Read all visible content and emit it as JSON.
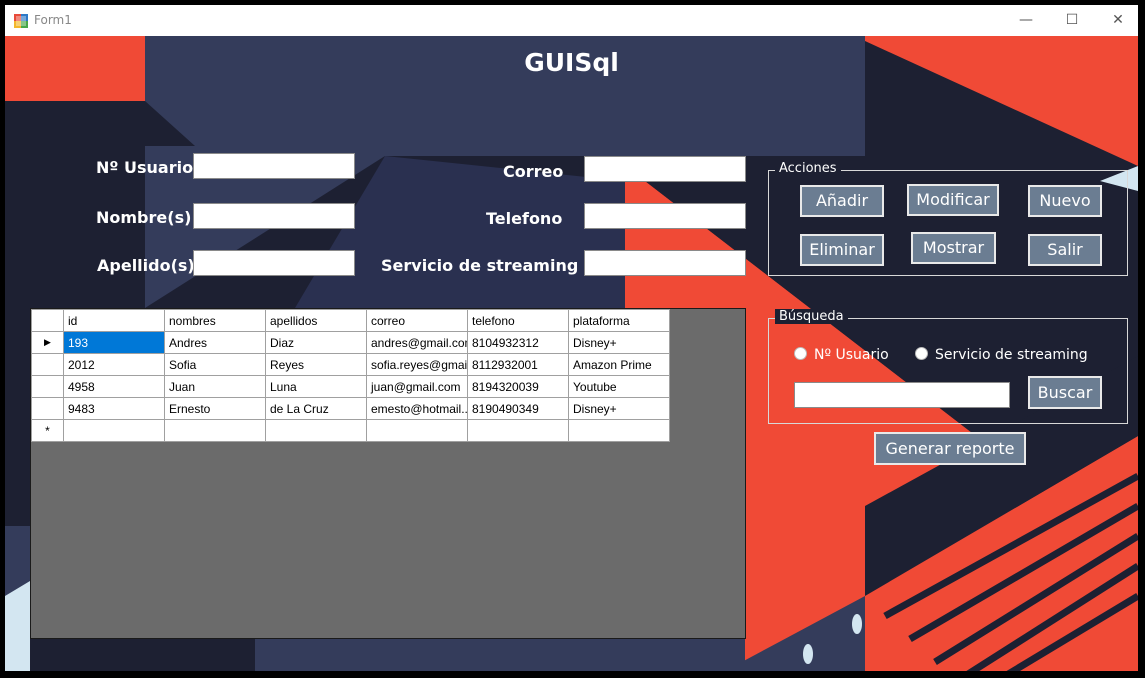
{
  "window": {
    "title": "Form1",
    "controls": {
      "minimize": "—",
      "maximize": "☐",
      "close": "✕"
    }
  },
  "header": {
    "title": "GUISql"
  },
  "form": {
    "usuario_label": "Nº Usuario",
    "nombres_label": "Nombre(s)",
    "apellidos_label": "Apellido(s)",
    "correo_label": "Correo",
    "telefono_label": "Telefono",
    "servicio_label": "Servicio de streaming",
    "usuario_value": "",
    "nombres_value": "",
    "apellidos_value": "",
    "correo_value": "",
    "telefono_value": "",
    "servicio_value": ""
  },
  "acciones": {
    "title": "Acciones",
    "anadir": "Añadir",
    "modificar": "Modificar",
    "nuevo": "Nuevo",
    "eliminar": "Eliminar",
    "mostrar": "Mostrar",
    "salir": "Salir"
  },
  "busqueda": {
    "title": "Búsqueda",
    "radio_usuario": "Nº Usuario",
    "radio_servicio": "Servicio de streaming",
    "search_value": "",
    "buscar": "Buscar"
  },
  "report_button": "Generar reporte",
  "table": {
    "columns": [
      "id",
      "nombres",
      "apellidos",
      "correo",
      "telefono",
      "plataforma"
    ],
    "rows": [
      [
        "193",
        "Andres",
        "Diaz",
        "andres@gmail.com",
        "8104932312",
        "Disney+"
      ],
      [
        "2012",
        "Sofia",
        "Reyes",
        "sofia.reyes@gmai...",
        "8112932001",
        "Amazon Prime"
      ],
      [
        "4958",
        "Juan",
        "Luna",
        "juan@gmail.com",
        "8194320039",
        "Youtube"
      ],
      [
        "9483",
        "Ernesto",
        "de La Cruz",
        "emesto@hotmail....",
        "8190490349",
        "Disney+"
      ]
    ],
    "current_row_marker": "▶",
    "new_row_marker": "*"
  },
  "colors": {
    "bg_dark": "#1d2032",
    "bg_navy": "#343c5b",
    "accent_red": "#f04a36",
    "button": "#6b7d92",
    "selection": "#0078d7"
  },
  "icons": {
    "app": "winforms-app-icon"
  }
}
